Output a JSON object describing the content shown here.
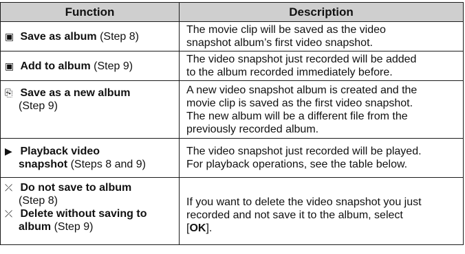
{
  "headers": {
    "function": "Function",
    "description": "Description"
  },
  "rows": [
    {
      "icon": "album-add-icon",
      "icon_glyph": "▣",
      "name": "Save as album",
      "step": "(Step 8)",
      "desc_lines": [
        "The movie clip will be saved as the video",
        "snapshot album’s first video snapshot."
      ]
    },
    {
      "icon": "album-add-icon",
      "icon_glyph": "▣",
      "name": "Add to album",
      "step": "(Step 9)",
      "desc_lines": [
        "The video snapshot just recorded will be added",
        "to the album recorded immediately before."
      ]
    },
    {
      "icon": "new-album-icon",
      "icon_glyph": "⎘",
      "name": "Save as a new album",
      "step": "(Step 9)",
      "desc_lines": [
        "A new video snapshot album is created and the",
        "movie clip is saved as the first video snapshot.",
        "The new album will be a different file from the",
        "previously recorded album."
      ]
    },
    {
      "icon": "playback-icon",
      "icon_glyph": "▶",
      "name_line1": "Playback video",
      "name_line2": "snapshot",
      "step": "(Steps 8 and 9)",
      "desc_lines": [
        "The video snapshot just recorded will be played.",
        "For playback operations, see the table below."
      ]
    },
    {
      "icon": "no-save-icon",
      "icon_glyph": "⤫",
      "name_a": "Do not save to album",
      "step_a": "(Step 8)",
      "name_b_line1": "Delete without saving to",
      "name_b_line2": "album",
      "step_b": "(Step 9)",
      "desc_lines": [
        "If you want to delete the video snapshot you just",
        "recorded and not save it to the album, select"
      ],
      "desc_tail_open": "[",
      "desc_ok": "OK",
      "desc_tail_close": "]."
    }
  ]
}
